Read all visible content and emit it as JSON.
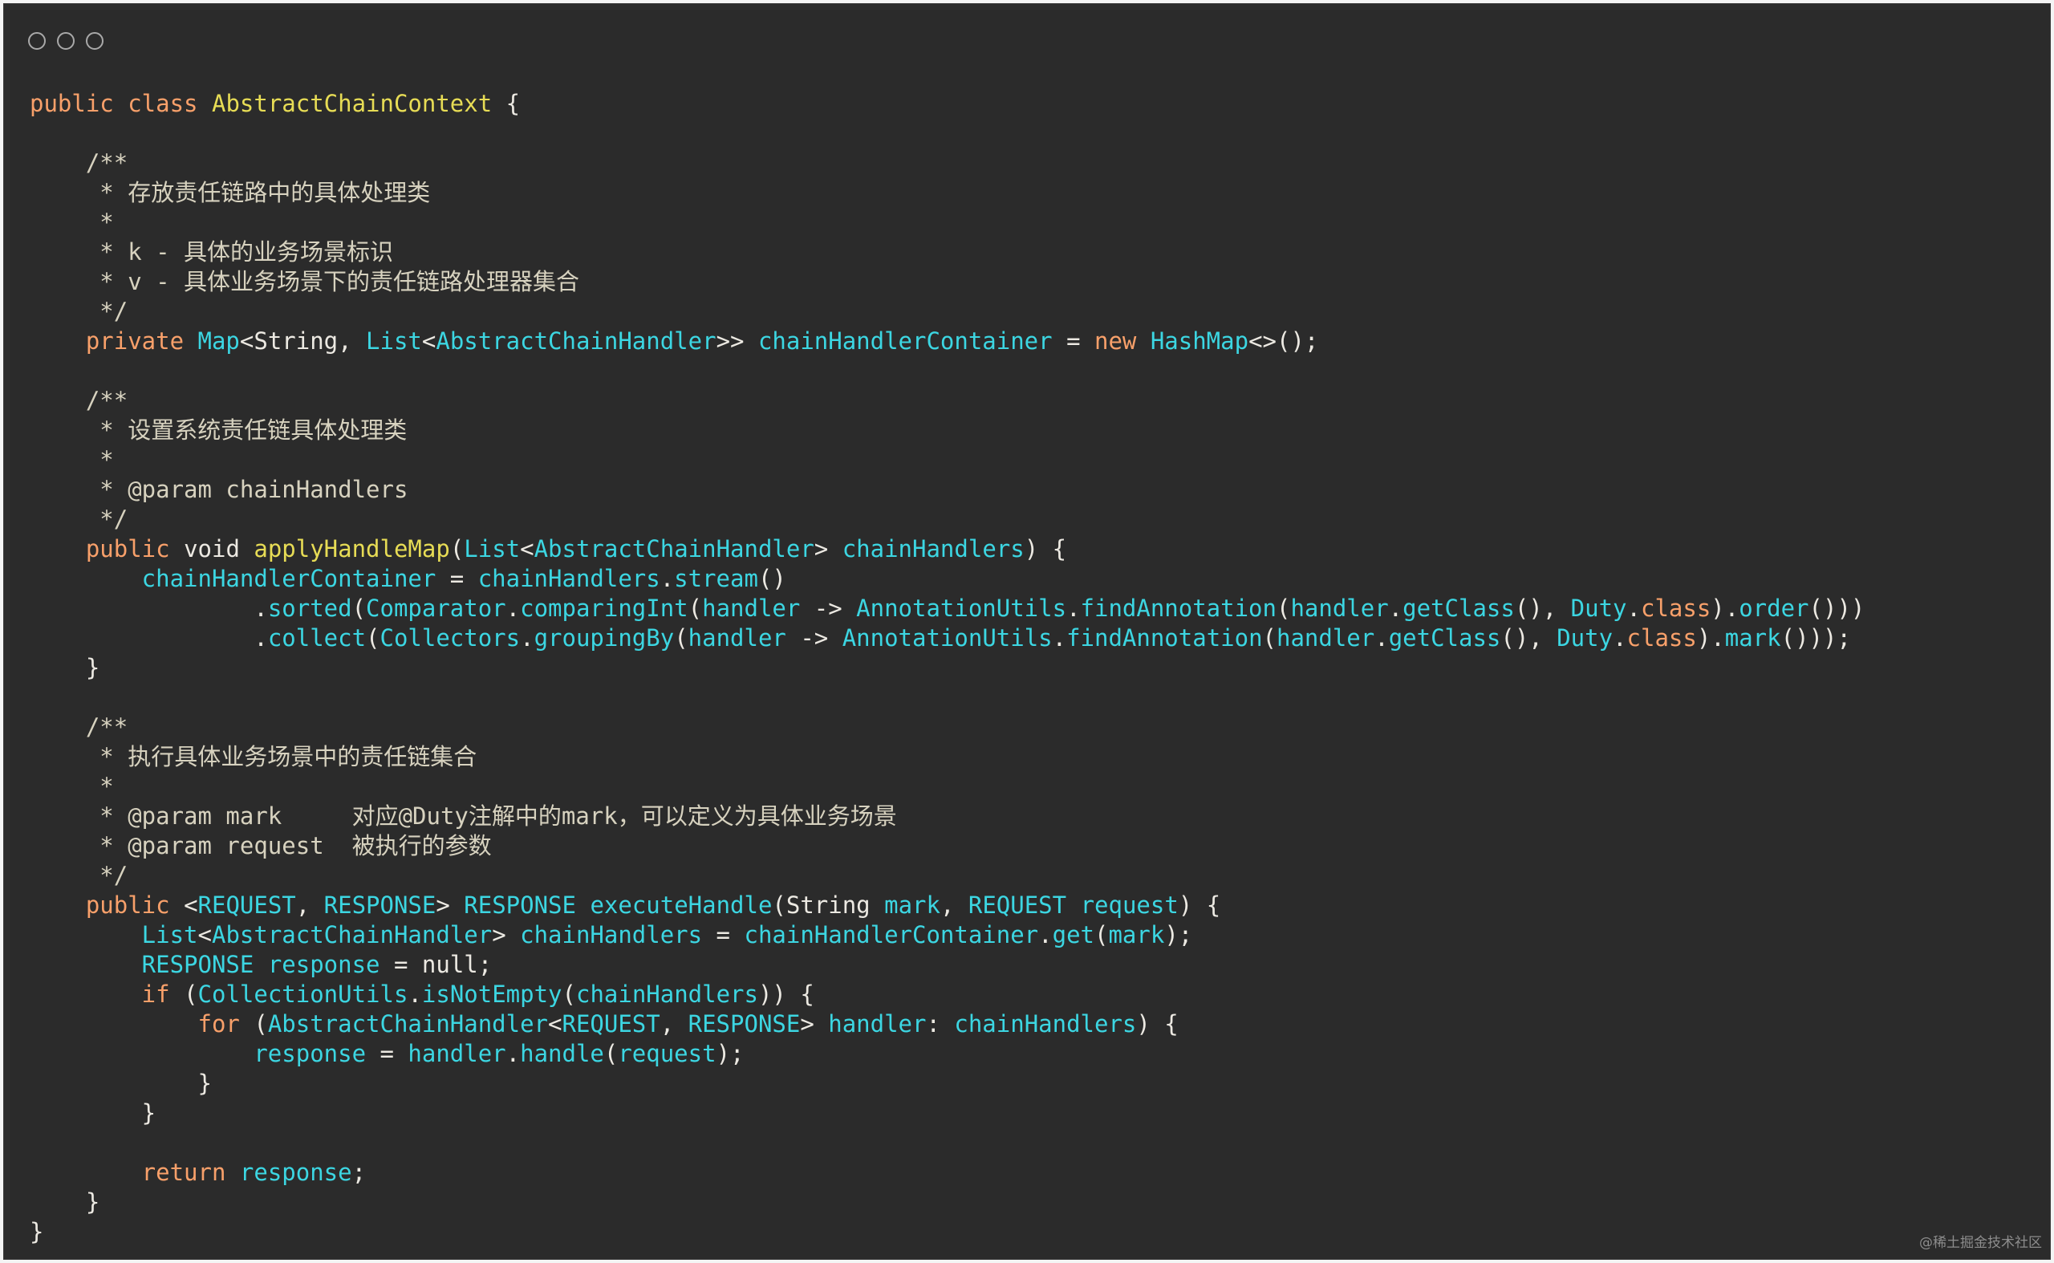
{
  "window": {
    "title_dots": [
      "circle",
      "circle",
      "circle"
    ]
  },
  "code_lines": [
    [
      [
        "k",
        "public class "
      ],
      [
        "f",
        "AbstractChainContext"
      ],
      [
        "p",
        " {"
      ]
    ],
    [],
    [
      [
        "c",
        "    /**"
      ]
    ],
    [
      [
        "c",
        "     * 存放责任链路中的具体处理类"
      ]
    ],
    [
      [
        "c",
        "     *"
      ]
    ],
    [
      [
        "c",
        "     * k - 具体的业务场景标识"
      ]
    ],
    [
      [
        "c",
        "     * v - 具体业务场景下的责任链路处理器集合"
      ]
    ],
    [
      [
        "c",
        "     */"
      ]
    ],
    [
      [
        "k",
        "    private "
      ],
      [
        "t",
        "Map"
      ],
      [
        "p",
        "<String, "
      ],
      [
        "t",
        "List"
      ],
      [
        "p",
        "<"
      ],
      [
        "t",
        "AbstractChainHandler"
      ],
      [
        "p",
        ">> "
      ],
      [
        "t",
        "chainHandlerContainer"
      ],
      [
        "p",
        " = "
      ],
      [
        "k",
        "new "
      ],
      [
        "t",
        "HashMap"
      ],
      [
        "p",
        "<>();"
      ]
    ],
    [],
    [
      [
        "c",
        "    /**"
      ]
    ],
    [
      [
        "c",
        "     * 设置系统责任链具体处理类"
      ]
    ],
    [
      [
        "c",
        "     *"
      ]
    ],
    [
      [
        "c",
        "     * @param chainHandlers"
      ]
    ],
    [
      [
        "c",
        "     */"
      ]
    ],
    [
      [
        "k",
        "    public "
      ],
      [
        "p",
        "void "
      ],
      [
        "f",
        "applyHandleMap"
      ],
      [
        "p",
        "("
      ],
      [
        "t",
        "List"
      ],
      [
        "p",
        "<"
      ],
      [
        "t",
        "AbstractChainHandler"
      ],
      [
        "p",
        "> "
      ],
      [
        "t",
        "chainHandlers"
      ],
      [
        "p",
        ") {"
      ]
    ],
    [
      [
        "t",
        "        chainHandlerContainer"
      ],
      [
        "p",
        " = "
      ],
      [
        "t",
        "chainHandlers"
      ],
      [
        "p",
        "."
      ],
      [
        "t",
        "stream"
      ],
      [
        "p",
        "()"
      ]
    ],
    [
      [
        "p",
        "                ."
      ],
      [
        "t",
        "sorted"
      ],
      [
        "p",
        "("
      ],
      [
        "t",
        "Comparator"
      ],
      [
        "p",
        "."
      ],
      [
        "t",
        "comparingInt"
      ],
      [
        "p",
        "("
      ],
      [
        "t",
        "handler"
      ],
      [
        "p",
        " -> "
      ],
      [
        "t",
        "AnnotationUtils"
      ],
      [
        "p",
        "."
      ],
      [
        "t",
        "findAnnotation"
      ],
      [
        "p",
        "("
      ],
      [
        "t",
        "handler"
      ],
      [
        "p",
        "."
      ],
      [
        "t",
        "getClass"
      ],
      [
        "p",
        "(), "
      ],
      [
        "t",
        "Duty"
      ],
      [
        "p",
        "."
      ],
      [
        "k",
        "class"
      ],
      [
        "p",
        ")."
      ],
      [
        "t",
        "order"
      ],
      [
        "p",
        "()))"
      ]
    ],
    [
      [
        "p",
        "                ."
      ],
      [
        "t",
        "collect"
      ],
      [
        "p",
        "("
      ],
      [
        "t",
        "Collectors"
      ],
      [
        "p",
        "."
      ],
      [
        "t",
        "groupingBy"
      ],
      [
        "p",
        "("
      ],
      [
        "t",
        "handler"
      ],
      [
        "p",
        " -> "
      ],
      [
        "t",
        "AnnotationUtils"
      ],
      [
        "p",
        "."
      ],
      [
        "t",
        "findAnnotation"
      ],
      [
        "p",
        "("
      ],
      [
        "t",
        "handler"
      ],
      [
        "p",
        "."
      ],
      [
        "t",
        "getClass"
      ],
      [
        "p",
        "(), "
      ],
      [
        "t",
        "Duty"
      ],
      [
        "p",
        "."
      ],
      [
        "k",
        "class"
      ],
      [
        "p",
        ")."
      ],
      [
        "t",
        "mark"
      ],
      [
        "p",
        "()));"
      ]
    ],
    [
      [
        "p",
        "    }"
      ]
    ],
    [],
    [
      [
        "c",
        "    /**"
      ]
    ],
    [
      [
        "c",
        "     * 执行具体业务场景中的责任链集合"
      ]
    ],
    [
      [
        "c",
        "     *"
      ]
    ],
    [
      [
        "c",
        "     * @param mark     对应@Duty注解中的mark，可以定义为具体业务场景"
      ]
    ],
    [
      [
        "c",
        "     * @param request  被执行的参数"
      ]
    ],
    [
      [
        "c",
        "     */"
      ]
    ],
    [
      [
        "k",
        "    public "
      ],
      [
        "p",
        "<"
      ],
      [
        "t",
        "REQUEST"
      ],
      [
        "p",
        ", "
      ],
      [
        "t",
        "RESPONSE"
      ],
      [
        "p",
        "> "
      ],
      [
        "t",
        "RESPONSE"
      ],
      [
        "p",
        " "
      ],
      [
        "t",
        "executeHandle"
      ],
      [
        "p",
        "(String "
      ],
      [
        "t",
        "mark"
      ],
      [
        "p",
        ", "
      ],
      [
        "t",
        "REQUEST"
      ],
      [
        "p",
        " "
      ],
      [
        "t",
        "request"
      ],
      [
        "p",
        ") {"
      ]
    ],
    [
      [
        "t",
        "        List"
      ],
      [
        "p",
        "<"
      ],
      [
        "t",
        "AbstractChainHandler"
      ],
      [
        "p",
        "> "
      ],
      [
        "t",
        "chainHandlers"
      ],
      [
        "p",
        " = "
      ],
      [
        "t",
        "chainHandlerContainer"
      ],
      [
        "p",
        "."
      ],
      [
        "t",
        "get"
      ],
      [
        "p",
        "("
      ],
      [
        "t",
        "mark"
      ],
      [
        "p",
        ");"
      ]
    ],
    [
      [
        "t",
        "        RESPONSE"
      ],
      [
        "p",
        " "
      ],
      [
        "t",
        "response"
      ],
      [
        "p",
        " = null;"
      ]
    ],
    [
      [
        "k",
        "        if "
      ],
      [
        "p",
        "("
      ],
      [
        "t",
        "CollectionUtils"
      ],
      [
        "p",
        "."
      ],
      [
        "t",
        "isNotEmpty"
      ],
      [
        "p",
        "("
      ],
      [
        "t",
        "chainHandlers"
      ],
      [
        "p",
        ")) {"
      ]
    ],
    [
      [
        "k",
        "            for "
      ],
      [
        "p",
        "("
      ],
      [
        "t",
        "AbstractChainHandler"
      ],
      [
        "p",
        "<"
      ],
      [
        "t",
        "REQUEST"
      ],
      [
        "p",
        ", "
      ],
      [
        "t",
        "RESPONSE"
      ],
      [
        "p",
        "> "
      ],
      [
        "t",
        "handler"
      ],
      [
        "p",
        ": "
      ],
      [
        "t",
        "chainHandlers"
      ],
      [
        "p",
        ") {"
      ]
    ],
    [
      [
        "t",
        "                response"
      ],
      [
        "p",
        " = "
      ],
      [
        "t",
        "handler"
      ],
      [
        "p",
        "."
      ],
      [
        "t",
        "handle"
      ],
      [
        "p",
        "("
      ],
      [
        "t",
        "request"
      ],
      [
        "p",
        ");"
      ]
    ],
    [
      [
        "p",
        "            }"
      ]
    ],
    [
      [
        "p",
        "        }"
      ]
    ],
    [],
    [
      [
        "k",
        "        return "
      ],
      [
        "t",
        "response"
      ],
      [
        "p",
        ";"
      ]
    ],
    [
      [
        "p",
        "    }"
      ]
    ],
    [
      [
        "p",
        "}"
      ]
    ]
  ],
  "watermark": "@稀土掘金技术社区"
}
